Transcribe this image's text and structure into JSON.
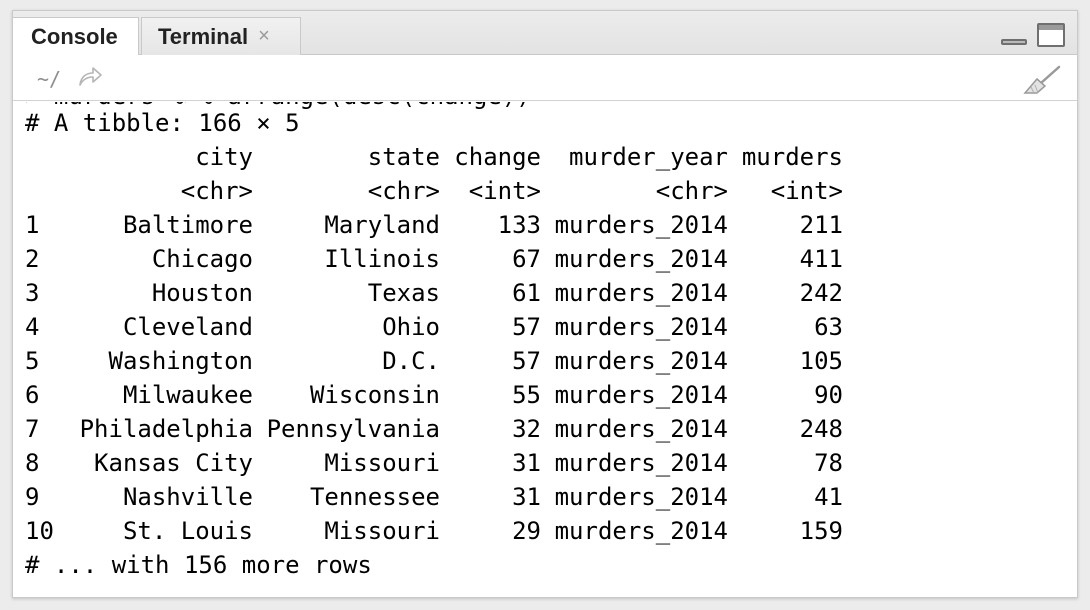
{
  "tabs": [
    {
      "label": "Console"
    },
    {
      "label": "Terminal",
      "close": "×"
    }
  ],
  "path": {
    "text": "~/"
  },
  "colors": {
    "text": "#000000",
    "muted": "#8e8e8e",
    "pane_bg": "#ffffff"
  },
  "icons": {
    "path_go": "go-to-directory-arrow",
    "clear": "broom-clear-console",
    "minimize": "minimize-pane",
    "maximize": "maximize-pane"
  },
  "console": {
    "summary": "# A tibble: 166 × 5",
    "headers": [
      "city",
      "state",
      "change",
      "murder_year",
      "murders"
    ],
    "types": [
      "<chr>",
      "<chr>",
      "<int>",
      "<chr>",
      "<int>"
    ],
    "rows": [
      {
        "n": "1",
        "city": "Baltimore",
        "state": "Maryland",
        "change": "133",
        "murder_year": "murders_2014",
        "murders": "211"
      },
      {
        "n": "2",
        "city": "Chicago",
        "state": "Illinois",
        "change": "67",
        "murder_year": "murders_2014",
        "murders": "411"
      },
      {
        "n": "3",
        "city": "Houston",
        "state": "Texas",
        "change": "61",
        "murder_year": "murders_2014",
        "murders": "242"
      },
      {
        "n": "4",
        "city": "Cleveland",
        "state": "Ohio",
        "change": "57",
        "murder_year": "murders_2014",
        "murders": "63"
      },
      {
        "n": "5",
        "city": "Washington",
        "state": "D.C.",
        "change": "57",
        "murder_year": "murders_2014",
        "murders": "105"
      },
      {
        "n": "6",
        "city": "Milwaukee",
        "state": "Wisconsin",
        "change": "55",
        "murder_year": "murders_2014",
        "murders": "90"
      },
      {
        "n": "7",
        "city": "Philadelphia",
        "state": "Pennsylvania",
        "change": "32",
        "murder_year": "murders_2014",
        "murders": "248"
      },
      {
        "n": "8",
        "city": "Kansas City",
        "state": "Missouri",
        "change": "31",
        "murder_year": "murders_2014",
        "murders": "78"
      },
      {
        "n": "9",
        "city": "Nashville",
        "state": "Tennessee",
        "change": "31",
        "murder_year": "murders_2014",
        "murders": "41"
      },
      {
        "n": "10",
        "city": "St. Louis",
        "state": "Missouri",
        "change": "29",
        "murder_year": "murders_2014",
        "murders": "159"
      }
    ],
    "footer": "# ... with 156 more rows"
  }
}
